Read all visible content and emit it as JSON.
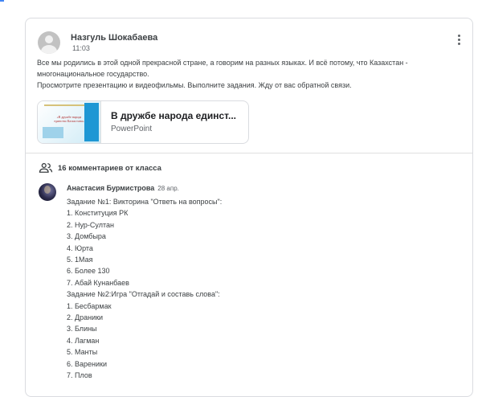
{
  "post": {
    "author": "Назгуль Шокабаева",
    "time": "11:03",
    "text_lines": [
      "Все мы родились в этой одной прекрасной стране, а говорим на разных языках. И всё потому, что Казахстан -",
      "многонациональное государство.",
      "Просмотрите презентацию и видеофильмы. Выполните задания. Жду от вас обратной связи."
    ],
    "attachment": {
      "title": "В дружбе народа единст...",
      "type": "PowerPoint",
      "thumb_caption": "«В дружбе народа единство Казахстана»"
    }
  },
  "comments_header": {
    "label": "16 комментариев от класса",
    "icon": "people-icon"
  },
  "comment": {
    "author": "Анастасия Бурмистрова",
    "date": "28 апр.",
    "lines": [
      "Задание №1: Викторина \"Ответь на вопросы\":",
      "1. Конституция РК",
      "2. Нур-Султан",
      "3. Домбыра",
      "4. Юрта",
      "5. 1Мая",
      "6. Более 130",
      "7. Абай Кунанбаев",
      "Задание №2:Игра \"Отгадай и составь слова\":",
      "1. Бесбармак",
      "2. Драники",
      "3. Блины",
      "4. Лагман",
      "5. Манты",
      "6. Вареники",
      "7. Плов"
    ]
  },
  "colors": {
    "border": "#dadce0",
    "text": "#3c4043",
    "secondary": "#5f6368"
  }
}
